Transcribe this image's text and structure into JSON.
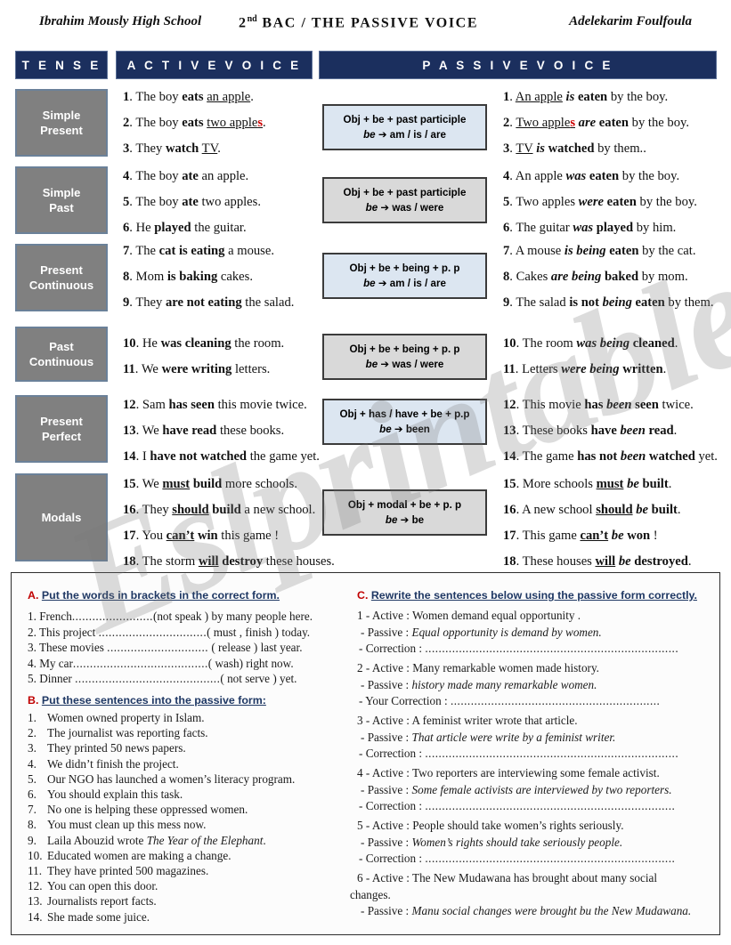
{
  "header": {
    "school": "Ibrahim Mously High School",
    "title_prefix": "2",
    "title_sup": "nd",
    "title_rest": " BAC / THE PASSIVE VOICE",
    "author": "Adelekarim Foulfoula"
  },
  "watermark": "Eslprintables.com",
  "colors": {
    "header_bar": "#1b2f5e",
    "tense_cell": "#808080",
    "formula_blue": "#dce6f1",
    "formula_grey": "#d9d9d9",
    "heading_blue": "#1f3864",
    "letter_red": "#c00000"
  },
  "columns": {
    "tense": "T E N S E",
    "active": "A C T I V E   V O I C E",
    "passive": "P A S S I V E   V O I C E"
  },
  "rows": [
    {
      "tense": "Simple Present",
      "formula_line1": "Obj + be + past participle",
      "formula_line2_be": "be",
      "formula_line2_val": "am / is / are",
      "formula_style": "blue",
      "active": [
        "1. The boy  eats an apple.",
        "2. The boy  eats two apples.",
        "3. They watch  TV."
      ],
      "passive": [
        "1. An apple is eaten by the boy.",
        "2. Two apples are eaten by the boy.",
        "3. TV is watched by them.."
      ]
    },
    {
      "tense": "Simple Past",
      "formula_line1": "Obj + be + past participle",
      "formula_line2_be": "be",
      "formula_line2_val": "was / were",
      "formula_style": "grey",
      "active": [
        "4. The boy  ate an apple.",
        "5. The boy ate two apples.",
        "6. He  played the guitar."
      ],
      "passive": [
        "4. An apple was eaten by the boy.",
        "5. Two apples were eaten by the boy.",
        "6. The guitar was played by him."
      ]
    },
    {
      "tense": "Present Continuous",
      "formula_line1": "Obj + be + being + p. p",
      "formula_line2_be": "be",
      "formula_line2_val": "am / is / are",
      "formula_style": "blue",
      "active": [
        "7. The cat is eating a mouse.",
        "8. Mom  is baking cakes.",
        "9. They  are not eating the salad."
      ],
      "passive": [
        "7. A mouse is being  eaten by the cat.",
        "8. Cakes are being baked by mom.",
        "9. The salad  is not being eaten by them."
      ]
    },
    {
      "tense": "Past Continuous",
      "formula_line1": "Obj + be + being + p. p",
      "formula_line2_be": "be",
      "formula_line2_val": "was / were",
      "formula_style": "grey",
      "active": [
        "10. He  was cleaning the room.",
        "11. We were writing  letters."
      ],
      "passive": [
        "10. The room was being cleaned.",
        "11. Letters were being written."
      ]
    },
    {
      "tense": "Present Perfect",
      "formula_line1": "Obj + has / have + be + p.p",
      "formula_line2_be": "be",
      "formula_line2_val": "been",
      "formula_style": "blue",
      "active": [
        "12. Sam has seen this  movie twice.",
        "13. We  have read these books.",
        "14. I have not watched the game yet."
      ],
      "passive": [
        "12. This movie has been seen twice.",
        "13. These books have been read.",
        "14. The game has not been watched yet."
      ]
    },
    {
      "tense": "Modals",
      "formula_line1": "Obj +  modal + be + p. p",
      "formula_line2_be": "be",
      "formula_line2_val": "be",
      "formula_style": "grey",
      "active": [
        "15. We  must build more schools.",
        "16. They should build  a new school.",
        "17. You  can't win this game !",
        "18. The storm will destroy these houses."
      ],
      "passive": [
        "15. More schools must  be built.",
        "16. A new school should  be built.",
        "17. This game can't  be won !",
        "18. These  houses will  be destroyed."
      ]
    }
  ],
  "exercises": {
    "A": {
      "letter": "A.",
      "title": "Put the words in brackets  in the correct form.",
      "items": [
        {
          "num": "1.",
          "pre": "French",
          "dots": "........................",
          "post": "(not  speak ) by many people here."
        },
        {
          "num": "2.",
          "pre": "This project ",
          "dots": "................................",
          "post": "( must , finish ) today."
        },
        {
          "num": "3.",
          "pre": "These movies ",
          "dots": "..............................",
          "post": " ( release ) last year."
        },
        {
          "num": "4.",
          "pre": "My car",
          "dots": "........................................",
          "post": "( wash) right now."
        },
        {
          "num": "5.",
          "pre": "Dinner  ",
          "dots": "...........................................",
          "post": "( not serve ) yet."
        }
      ]
    },
    "B": {
      "letter": "B.",
      "title": "Put these sentences into the passive form:",
      "items": [
        {
          "num": "1.",
          "text": "Women owned property in Islam."
        },
        {
          "num": "2.",
          "text": "The journalist was reporting facts."
        },
        {
          "num": "3.",
          "text": "They printed  50 news papers."
        },
        {
          "num": "4.",
          "text": "We didn’t finish the project."
        },
        {
          "num": "5.",
          "text": "Our NGO  has launched a women’s literacy program."
        },
        {
          "num": "6.",
          "text": "You should explain this task."
        },
        {
          "num": "7.",
          "text": "No one is helping these oppressed women."
        },
        {
          "num": "8.",
          "text": "You must clean up this mess now."
        },
        {
          "num": "9.",
          "text": "Laila Abouzid   wrote ",
          "italic": "The Year of the Elephant",
          "tail": "."
        },
        {
          "num": "10.",
          "text": "Educated women are making a change."
        },
        {
          "num": "11.",
          "text": "They have printed 500 magazines."
        },
        {
          "num": "12.",
          "text": "You  can  open this door."
        },
        {
          "num": "13.",
          "text": "Journalists report facts."
        },
        {
          "num": "14.",
          "text": "She made some juice."
        }
      ]
    },
    "C": {
      "letter": "C.",
      "title": "Rewrite the sentences below using the passive form correctly.",
      "items": [
        {
          "active_label": "1 -  Active  :",
          "active": "Women demand equal opportunity .",
          "passive_label": "-  Passive :",
          "passive": "Equal opportunity  is  demand  by women.",
          "correction_label": "-  Correction  :",
          "correction_dots": "..........................................................................."
        },
        {
          "active_label": "2 -  Active  :",
          "active": "Many remarkable women made history.",
          "passive_label": "-  Passive :",
          "passive": "history  made  many remarkable women.",
          "correction_label": "-  Your Correction  :",
          "correction_dots": ".............................................................."
        },
        {
          "active_label": "3 -  Active  :",
          "active": "A feminist writer  wrote that article.",
          "passive_label": "-  Passive :",
          "passive": "That  article were write by a feminist writer.",
          "correction_label": "-  Correction  :",
          "correction_dots": "..........................................................................."
        },
        {
          "active_label": "4 -  Active  :",
          "active": "Two reporters are interviewing  some female activist.",
          "passive_label": "-  Passive :",
          "passive": "Some female activists are interviewed by two reporters.",
          "correction_label": "-  Correction  :",
          "correction_dots": ".........................................................................."
        },
        {
          "active_label": "5 -  Active  :",
          "active": "People should  take women’s rights seriously.",
          "passive_label": "-  Passive :",
          "passive": "Women’s rights  should take  seriously people.",
          "correction_label": "-  Correction  :",
          "correction_dots": ".........................................................................."
        },
        {
          "active_label": "6 -  Active  :",
          "active": "The New Mudawana has brought about  many social",
          "active_cont": "changes.",
          "passive_label": "-  Passive :",
          "passive": "Manu social changes  were brought  bu the New Mudawana."
        }
      ]
    }
  }
}
